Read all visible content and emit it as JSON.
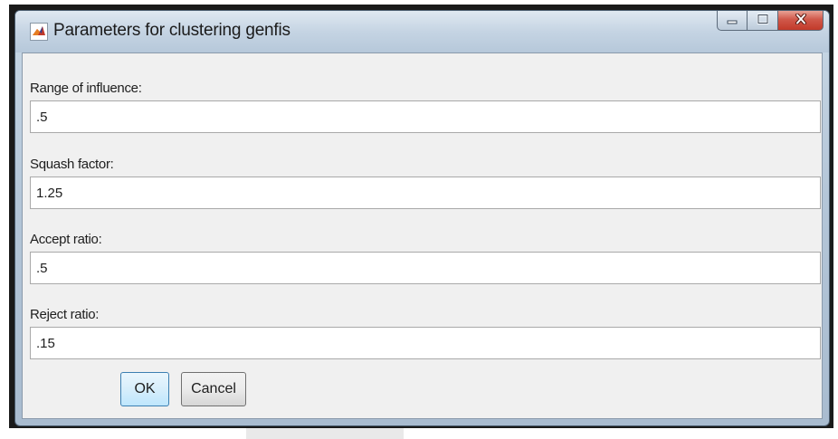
{
  "window": {
    "title": "Parameters for clustering genfis",
    "icon": "matlab-icon",
    "caption_buttons": {
      "minimize_icon": "minimize-icon",
      "maximize_icon": "maximize-icon",
      "close_icon": "close-icon"
    }
  },
  "fields": [
    {
      "label": "Range of influence:",
      "value": ".5"
    },
    {
      "label": "Squash factor:",
      "value": "1.25"
    },
    {
      "label": "Accept ratio:",
      "value": ".5"
    },
    {
      "label": "Reject ratio:",
      "value": ".15"
    }
  ],
  "buttons": {
    "ok_label": "OK",
    "cancel_label": "Cancel"
  },
  "colors": {
    "title_bar": "#c5d4e3",
    "close_button": "#c23a2a",
    "client_background": "#f0f0f0",
    "ok_button_border": "#3c7fb1"
  }
}
